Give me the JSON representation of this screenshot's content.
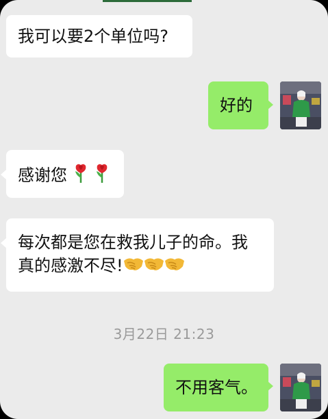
{
  "chat": {
    "messages": [
      {
        "side": "in",
        "text": "我可以要2个单位吗?"
      },
      {
        "side": "out",
        "text": "好的",
        "avatar": "user-avatar"
      },
      {
        "side": "in",
        "text": "感谢您",
        "emoji": [
          "rose-emoji",
          "rose-emoji"
        ]
      },
      {
        "side": "in",
        "line1": "每次都是您在救我儿子的命。我",
        "line2": "真的感激不尽!",
        "emoji": [
          "handshake-emoji",
          "handshake-emoji",
          "handshake-emoji"
        ]
      },
      {
        "side": "out",
        "text": "不用客气。",
        "avatar": "user-avatar"
      }
    ],
    "timestamp": "3月22日 21:23"
  },
  "colors": {
    "background": "#ebebeb",
    "bubble_in": "#ffffff",
    "bubble_out": "#95ec69",
    "timestamp": "#9a9a9a"
  }
}
